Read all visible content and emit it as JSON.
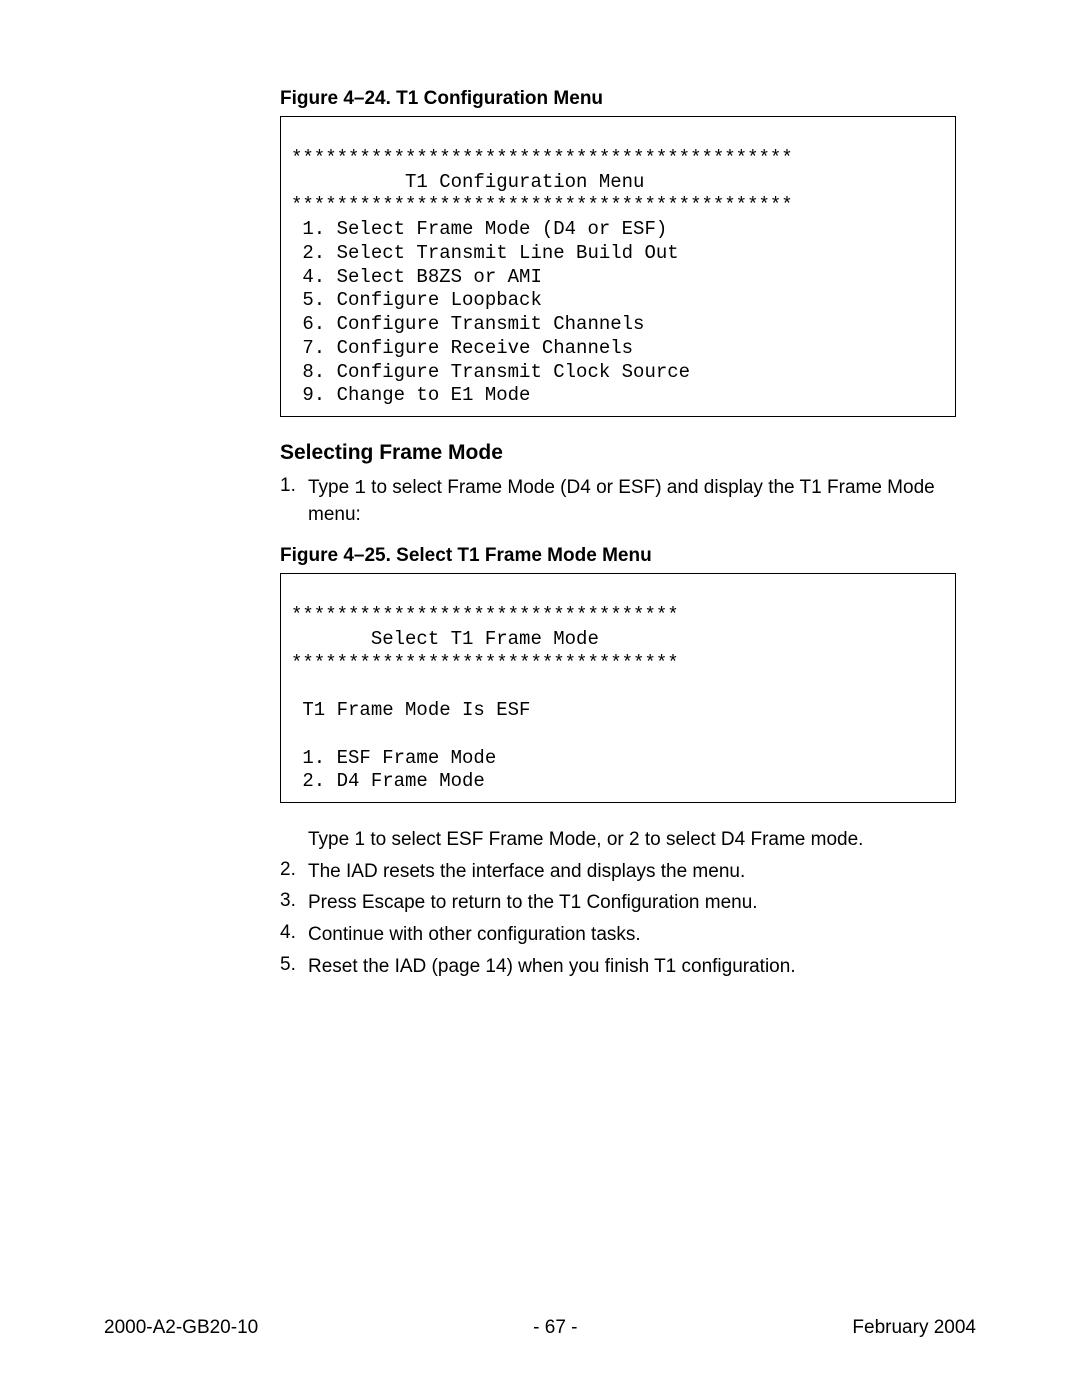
{
  "figure1": {
    "caption": "Figure 4–24.  T1 Configuration Menu",
    "lines": [
      "********************************************",
      "          T1 Configuration Menu",
      "********************************************",
      " 1. Select Frame Mode (D4 or ESF)",
      " 2. Select Transmit Line Build Out",
      " 4. Select B8ZS or AMI",
      " 5. Configure Loopback",
      " 6. Configure Transmit Channels",
      " 7. Configure Receive Channels",
      " 8. Configure Transmit Clock Source",
      " 9. Change to E1 Mode"
    ]
  },
  "section1": {
    "heading": "Selecting Frame Mode",
    "step1_num": "1.",
    "step1_pre": "Type ",
    "step1_mono": "1",
    "step1_post": " to select Frame Mode (D4 or ESF) and display the T1 Frame Mode menu:"
  },
  "figure2": {
    "caption": "Figure 4–25.  Select T1 Frame Mode Menu",
    "lines": [
      "**********************************",
      "       Select T1 Frame Mode",
      "**********************************",
      "",
      " T1 Frame Mode Is ESF",
      "",
      " 1. ESF Frame Mode",
      " 2. D4 Frame Mode"
    ]
  },
  "afterFig2": {
    "line1": "Type 1 to select ESF Frame Mode, or 2 to select D4 Frame mode.",
    "step2_num": "2.",
    "step2_text": "The IAD resets the interface and displays the menu.",
    "step3_num": "3.",
    "step3_text": "Press Escape to return to the T1 Configuration menu.",
    "step4_num": "4.",
    "step4_text": "Continue with other configuration tasks.",
    "step5_num": "5.",
    "step5_text": "Reset the IAD (page 14) when you finish T1 configuration."
  },
  "footer": {
    "left": "2000-A2-GB20-10",
    "center": "- 67 -",
    "right": "February 2004"
  }
}
